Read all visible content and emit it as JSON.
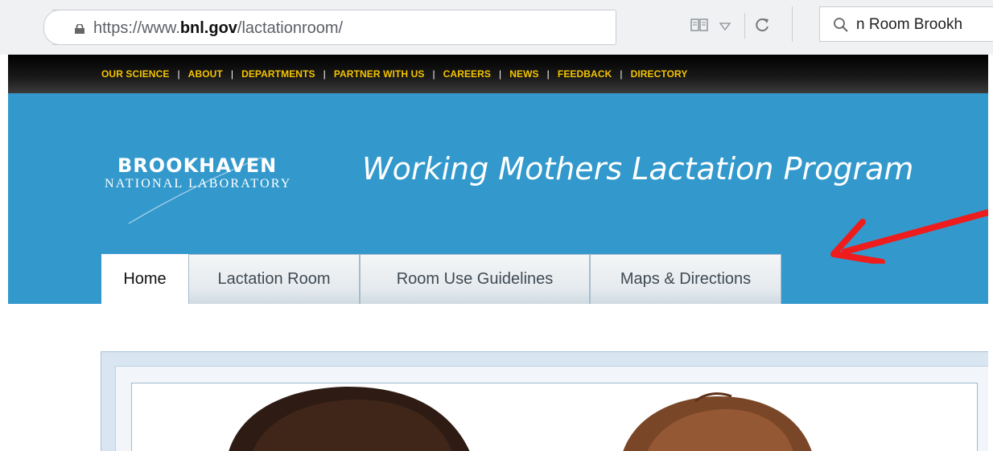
{
  "browser": {
    "url_scheme": "https://www.",
    "url_domain": "bnl.gov",
    "url_path": "/lactationroom/",
    "search_text": "n Room Brookh"
  },
  "topnav": {
    "items": [
      "OUR SCIENCE",
      "ABOUT",
      "DEPARTMENTS",
      "PARTNER WITH US",
      "CAREERS",
      "NEWS",
      "FEEDBACK",
      "DIRECTORY"
    ],
    "separator": "|"
  },
  "header": {
    "logo_main": "BROOKHAVEN",
    "logo_sub": "NATIONAL LABORATORY",
    "site_title": "Working Mothers Lactation Program",
    "background_color": "#3399cc"
  },
  "tabs": {
    "home": "Home",
    "lactation_room": "Lactation Room",
    "guidelines": "Room Use Guidelines",
    "maps": "Maps & Directions",
    "active": "Home"
  },
  "annotation": {
    "arrow_color": "#ee1c1c"
  },
  "colors": {
    "topnav_link": "#f4c400",
    "topnav_bg": "#000000"
  }
}
